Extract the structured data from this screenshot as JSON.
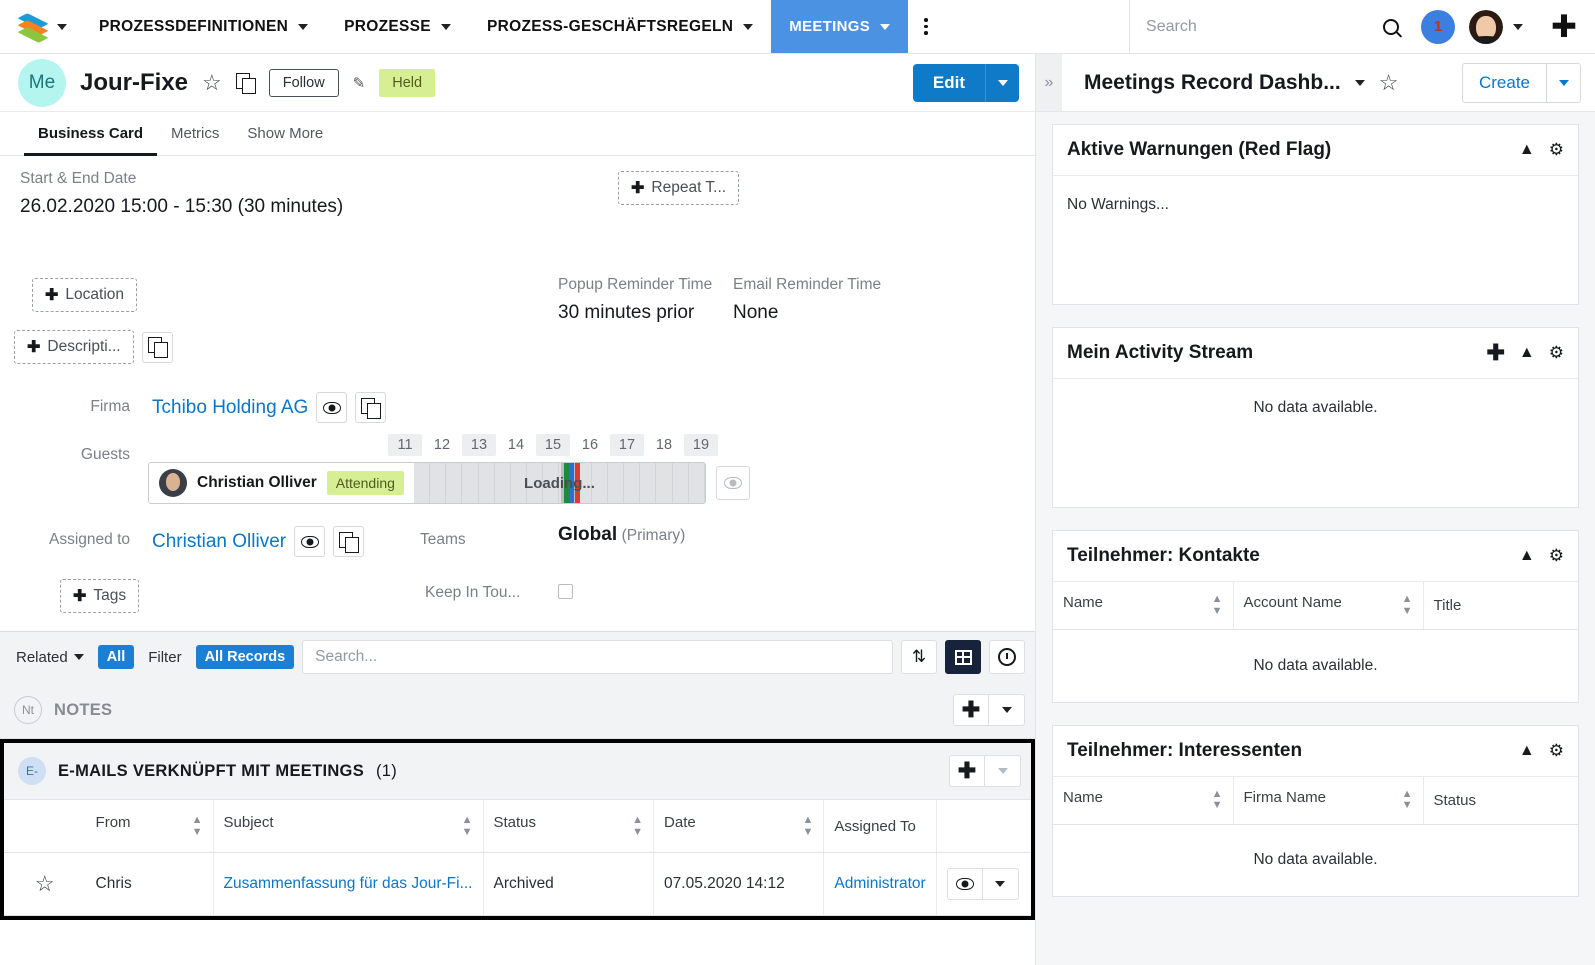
{
  "topnav": {
    "logo": "sugar-logo",
    "menus": [
      {
        "label": "PROZESSDEFINITIONEN",
        "active": false
      },
      {
        "label": "PROZESSE",
        "active": false
      },
      {
        "label": "PROZESS-GESCHÄFTSREGELN",
        "active": false
      },
      {
        "label": "MEETINGS",
        "active": true
      }
    ],
    "search_placeholder": "Search",
    "search_value": "",
    "notification_count": "1",
    "accent_color": "#4b92e2"
  },
  "record": {
    "avatar_initials": "Me",
    "title": "Jour-Fixe",
    "follow_label": "Follow",
    "status_badge": "Held",
    "edit_label": "Edit",
    "tabs": [
      {
        "label": "Business Card",
        "active": true
      },
      {
        "label": "Metrics",
        "active": false
      },
      {
        "label": "Show More",
        "active": false
      }
    ]
  },
  "fields": {
    "start_end_label": "Start & End Date",
    "start_end_value": "26.02.2020 15:00 - 15:30 (30 minutes)",
    "repeat_label": "Repeat T...",
    "location_label": "Location",
    "description_label": "Descripti...",
    "popup_reminder_label": "Popup Reminder Time",
    "popup_reminder_value": "30 minutes prior",
    "email_reminder_label": "Email Reminder Time",
    "email_reminder_value": "None",
    "firma_label": "Firma",
    "firma_value": "Tchibo Holding AG",
    "guests_label": "Guests",
    "guest_name": "Christian Olliver",
    "guest_status": "Attending",
    "timeline_loading": "Loading...",
    "timeline_hours": [
      "11",
      "12",
      "13",
      "14",
      "15",
      "16",
      "17",
      "18",
      "19"
    ],
    "assigned_to_label": "Assigned to",
    "assigned_to_value": "Christian Olliver",
    "teams_label": "Teams",
    "teams_value": "Global",
    "teams_suffix": "(Primary)",
    "tags_label": "Tags",
    "keep_in_touch_label": "Keep In Tou..."
  },
  "related_bar": {
    "related_label": "Related",
    "all_label": "All",
    "filter_label": "Filter",
    "all_records_label": "All Records",
    "search_placeholder": "Search...",
    "search_value": ""
  },
  "notes_panel": {
    "badge": "Nt",
    "title": "NOTES"
  },
  "emails_panel": {
    "badge": "E-",
    "title": "E-MAILS VERKNÜPFT MIT MEETINGS",
    "count": "(1)",
    "columns": [
      "From",
      "Subject",
      "Status",
      "Date",
      "Assigned To"
    ],
    "rows": [
      {
        "from": "Chris",
        "subject": "Zusammenfassung für das Jour-Fi...",
        "status": "Archived",
        "date": "07.05.2020 14:12",
        "assigned_to": "Administrator"
      }
    ]
  },
  "dashboard": {
    "title": "Meetings Record Dashb...",
    "create_label": "Create",
    "dashlets": [
      {
        "title": "Aktive Warnungen (Red Flag)",
        "has_add": false,
        "empty_text": "No Warnings...",
        "columns": []
      },
      {
        "title": "Mein Activity Stream",
        "has_add": true,
        "empty_text": "No data available.",
        "columns": []
      },
      {
        "title": "Teilnehmer: Kontakte",
        "has_add": false,
        "empty_text": "No data available.",
        "columns": [
          "Name",
          "Account Name",
          "Title"
        ]
      },
      {
        "title": "Teilnehmer: Interessenten",
        "has_add": false,
        "empty_text": "No data available.",
        "columns": [
          "Name",
          "Firma Name",
          "Status"
        ]
      }
    ]
  }
}
